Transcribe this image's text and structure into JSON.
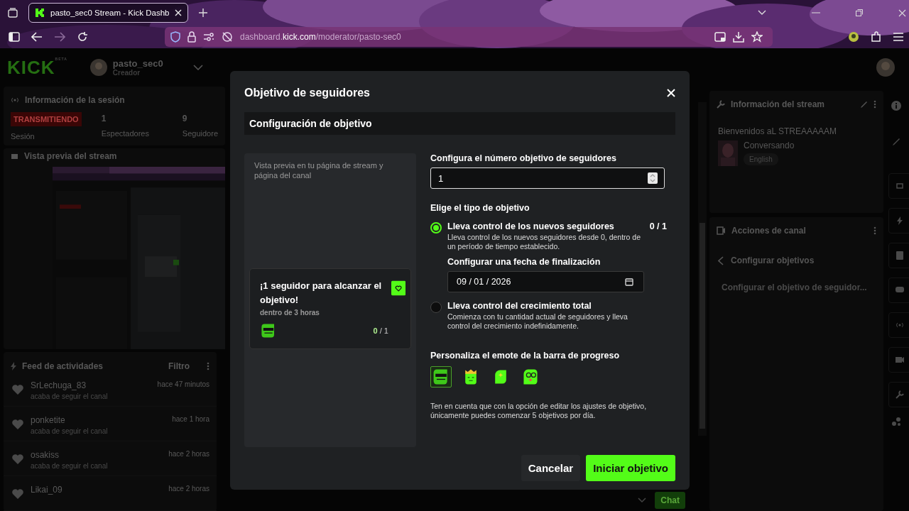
{
  "browser": {
    "tab_title": "pasto_sec0 Stream - Kick Dashb",
    "url": {
      "prefix": "dashboard.",
      "domain": "kick.com",
      "path": "/moderator/pasto-sec0"
    }
  },
  "header": {
    "logo": "KICK",
    "logo_badge": "BETA",
    "user": "pasto_sec0",
    "role": "Creador"
  },
  "session": {
    "title": "Información de la sesión",
    "status": "TRANSMITIENDO",
    "status_label": "Sesión",
    "stats": [
      {
        "value": "1",
        "label": "Espectadores"
      },
      {
        "value": "9",
        "label": "Seguidore"
      }
    ]
  },
  "preview": {
    "title": "Vista previa del stream"
  },
  "feed": {
    "title": "Feed de actividades",
    "filter": "Filtro",
    "items": [
      {
        "name": "SrLechuga_83",
        "action": "acaba de seguir el canal",
        "time": "hace 47 minutos"
      },
      {
        "name": "ponketite",
        "action": "acaba de seguir el canal",
        "time": "hace 1 hora"
      },
      {
        "name": "osakiss",
        "action": "acaba de seguir el canal",
        "time": "hace 2 horas"
      },
      {
        "name": "Likai_09",
        "time": "hace 2 horas"
      }
    ]
  },
  "chat_button": "Chat",
  "modal": {
    "title": "Objetivo de seguidores",
    "section": "Configuración de objetivo",
    "preview_caption": "Vista previa en tu página de stream y página del canal",
    "card": {
      "headline": "¡1 seguidor para alcanzar el objetivo!",
      "subtitle": "dentro de 3 horas",
      "current": "0",
      "rest": "/ 1"
    },
    "target": {
      "label": "Configura el número objetivo de seguidores",
      "value": "1"
    },
    "type_label": "Elige el tipo de objetivo",
    "options": [
      {
        "title": "Lleva control de los nuevos seguidores",
        "description": "Lleva control de los nuevos seguidores desde 0, dentro de un período de tiempo establecido.",
        "selected": true,
        "count": "0 / 1",
        "end_date": {
          "label": "Configurar una fecha de finalización",
          "value": "09 / 01 / 2026"
        }
      },
      {
        "title": "Lleva control del crecimiento total",
        "description": "Comienza con tu cantidad actual de seguidores y lleva control del crecimiento indefinidamente.",
        "selected": false
      }
    ],
    "emote_label": "Personaliza el emote de la barra de progreso",
    "emotes": [
      {
        "kind": "sunglasses",
        "selected": true
      },
      {
        "kind": "crown",
        "selected": false
      },
      {
        "kind": "sparkle",
        "selected": false
      },
      {
        "kind": "glasses",
        "selected": false
      }
    ],
    "note": "Ten en cuenta que con la opción de editar los ajustes de objetivo, únicamente puedes comenzar 5 objetivos por día.",
    "buttons": [
      {
        "label": "Cancelar",
        "kind": "secondary"
      },
      {
        "label": "Iniciar objetivo",
        "kind": "primary"
      }
    ]
  },
  "stream_info": {
    "title": "Información del stream",
    "stream_title": "Bienvenidos aL STREAAAAAM",
    "category": "Conversando",
    "tags": [
      "English"
    ]
  },
  "channel_actions": {
    "title": "Acciones de canal",
    "back": "Configurar objetivos",
    "items": [
      "Configurar el objetivo de seguidor..."
    ]
  }
}
